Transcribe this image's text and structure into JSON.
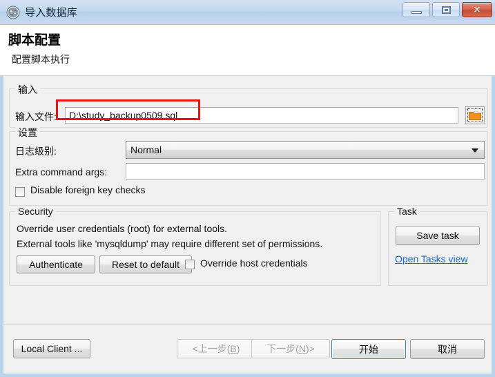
{
  "window": {
    "title": "导入数据库",
    "icon": "app-globe-icon",
    "controls": {
      "minimize": "minimize-icon",
      "maximize": "maximize-icon",
      "close": "✕"
    }
  },
  "header": {
    "title": "脚本配置",
    "subtitle": "配置脚本执行"
  },
  "input_group": {
    "label": "输入",
    "file_label": "输入文件:",
    "file_value": "D:\\study_backup0509.sql",
    "file_placeholder": "",
    "browse_icon": "folder-icon",
    "annotation_color": "#ee1111"
  },
  "settings_group": {
    "label": "设置",
    "log_level_label": "日志级别:",
    "log_level_value": "Normal",
    "log_level_options": [
      "Normal"
    ],
    "extra_args_label": "Extra command args:",
    "extra_args_value": "",
    "extra_args_placeholder": "",
    "disable_fk_label": "Disable foreign key checks",
    "disable_fk_checked": false
  },
  "security_group": {
    "label": "Security",
    "line1": "Override user credentials (root) for external tools.",
    "line2": "External tools like 'mysqldump' may require different set of permissions.",
    "authenticate_label": "Authenticate",
    "reset_label": "Reset to default",
    "override_host_label": "Override host credentials",
    "override_host_checked": false
  },
  "task_group": {
    "label": "Task",
    "save_task_label": "Save task",
    "open_tasks_label": "Open Tasks view"
  },
  "footer": {
    "local_client_label": "Local Client ...",
    "back_label_pre": "<上一步(",
    "back_accel": "B",
    "back_label_post": ")",
    "next_label_pre": "下一步(",
    "next_accel": "N",
    "next_label_post": ")>",
    "start_label": "开始",
    "cancel_label": "取消"
  }
}
